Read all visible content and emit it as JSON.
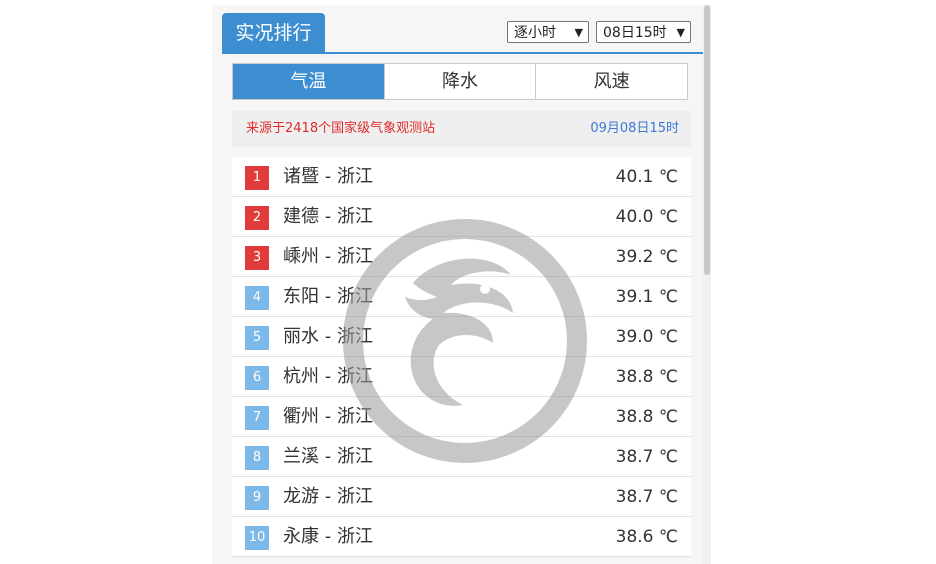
{
  "header": {
    "title": "实况排行",
    "mode_select": "逐小时",
    "time_select": "08日15时"
  },
  "tabs": [
    {
      "label": "气温",
      "active": true
    },
    {
      "label": "降水",
      "active": false
    },
    {
      "label": "风速",
      "active": false
    }
  ],
  "info": {
    "source": "来源于2418个国家级气象观测站",
    "time": "09月08日15时"
  },
  "rows": [
    {
      "rank": "1",
      "city": "诸暨 - 浙江",
      "value": "40.1 ℃"
    },
    {
      "rank": "2",
      "city": "建德 - 浙江",
      "value": "40.0 ℃"
    },
    {
      "rank": "3",
      "city": "嵊州 - 浙江",
      "value": "39.2 ℃"
    },
    {
      "rank": "4",
      "city": "东阳 - 浙江",
      "value": "39.1 ℃"
    },
    {
      "rank": "5",
      "city": "丽水 - 浙江",
      "value": "39.0 ℃"
    },
    {
      "rank": "6",
      "city": "杭州 - 浙江",
      "value": "38.8 ℃"
    },
    {
      "rank": "7",
      "city": "衢州 - 浙江",
      "value": "38.8 ℃"
    },
    {
      "rank": "8",
      "city": "兰溪 - 浙江",
      "value": "38.7 ℃"
    },
    {
      "rank": "9",
      "city": "龙游 - 浙江",
      "value": "38.7 ℃"
    },
    {
      "rank": "10",
      "city": "永康 - 浙江",
      "value": "38.6 ℃"
    }
  ],
  "colors": {
    "accent": "#3d8ed0",
    "top_rank": "#e23b3b",
    "other_rank": "#7cb9e8",
    "source_text": "#e02c2c",
    "time_text": "#3d79d6"
  },
  "icons": {
    "watermark": "dragon-logo-icon",
    "select_arrow": "chevron-down-icon"
  }
}
